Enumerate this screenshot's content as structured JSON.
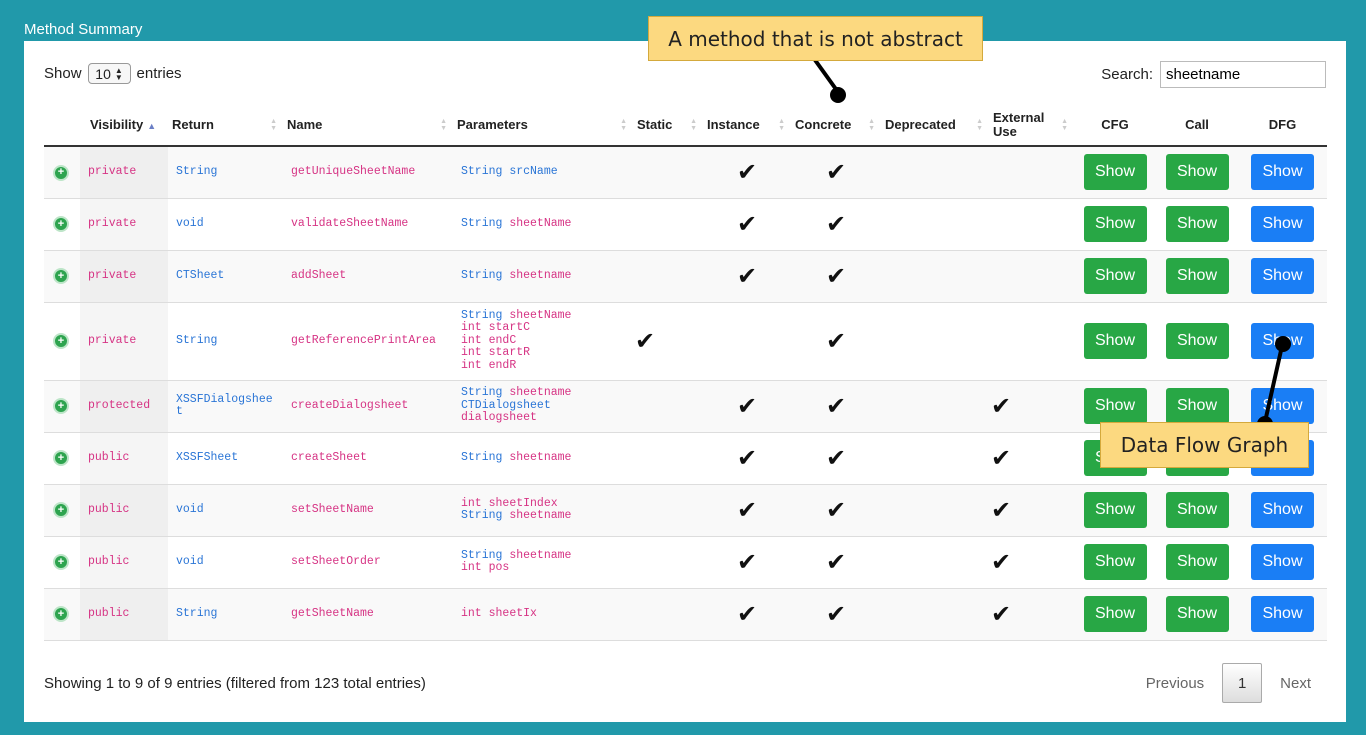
{
  "panel": {
    "title": "Method Summary"
  },
  "length": {
    "prefix": "Show",
    "value": "10",
    "suffix": "entries"
  },
  "search": {
    "label": "Search:",
    "value": "sheetname"
  },
  "columns": [
    {
      "label": ""
    },
    {
      "label": "Visibility"
    },
    {
      "label": "Return"
    },
    {
      "label": "Name"
    },
    {
      "label": "Parameters"
    },
    {
      "label": "Static"
    },
    {
      "label": "Instance"
    },
    {
      "label": "Concrete"
    },
    {
      "label": "Deprecated"
    },
    {
      "label": "External Use"
    },
    {
      "label": "CFG"
    },
    {
      "label": "Call"
    },
    {
      "label": "DFG"
    }
  ],
  "rows": [
    {
      "visibility": "private",
      "return": "String",
      "name": "getUniqueSheetName",
      "params": [
        {
          "type": "String",
          "name": "srcName",
          "tcolor": "blue",
          "ncolor": "blue"
        }
      ],
      "static": false,
      "instance": true,
      "concrete": true,
      "deprecated": false,
      "external": false
    },
    {
      "visibility": "private",
      "return": "void",
      "name": "validateSheetName",
      "params": [
        {
          "type": "String",
          "name": "sheetName",
          "tcolor": "blue",
          "ncolor": "pink"
        }
      ],
      "static": false,
      "instance": true,
      "concrete": true,
      "deprecated": false,
      "external": false
    },
    {
      "visibility": "private",
      "return": "CTSheet",
      "name": "addSheet",
      "params": [
        {
          "type": "String",
          "name": "sheetname",
          "tcolor": "blue",
          "ncolor": "pink"
        }
      ],
      "static": false,
      "instance": true,
      "concrete": true,
      "deprecated": false,
      "external": false
    },
    {
      "visibility": "private",
      "return": "String",
      "name": "getReferencePrintArea",
      "params": [
        {
          "type": "String",
          "name": "sheetName",
          "tcolor": "blue",
          "ncolor": "pink"
        },
        {
          "type": "int",
          "name": "startC",
          "tcolor": "pink",
          "ncolor": "pink"
        },
        {
          "type": "int",
          "name": "endC",
          "tcolor": "pink",
          "ncolor": "pink"
        },
        {
          "type": "int",
          "name": "startR",
          "tcolor": "pink",
          "ncolor": "pink"
        },
        {
          "type": "int",
          "name": "endR",
          "tcolor": "pink",
          "ncolor": "pink"
        }
      ],
      "static": true,
      "instance": false,
      "concrete": true,
      "deprecated": false,
      "external": false
    },
    {
      "visibility": "protected",
      "return": "XSSFDialogsheet",
      "name": "createDialogsheet",
      "params": [
        {
          "type": "String",
          "name": "sheetname",
          "tcolor": "blue",
          "ncolor": "pink"
        },
        {
          "type": "CTDialogsheet",
          "name": "dialogsheet",
          "tcolor": "blue",
          "ncolor": "pink"
        }
      ],
      "static": false,
      "instance": true,
      "concrete": true,
      "deprecated": false,
      "external": true
    },
    {
      "visibility": "public",
      "return": "XSSFSheet",
      "name": "createSheet",
      "params": [
        {
          "type": "String",
          "name": "sheetname",
          "tcolor": "blue",
          "ncolor": "pink"
        }
      ],
      "static": false,
      "instance": true,
      "concrete": true,
      "deprecated": false,
      "external": true
    },
    {
      "visibility": "public",
      "return": "void",
      "name": "setSheetName",
      "params": [
        {
          "type": "int",
          "name": "sheetIndex",
          "tcolor": "pink",
          "ncolor": "pink"
        },
        {
          "type": "String",
          "name": "sheetname",
          "tcolor": "blue",
          "ncolor": "pink"
        }
      ],
      "static": false,
      "instance": true,
      "concrete": true,
      "deprecated": false,
      "external": true
    },
    {
      "visibility": "public",
      "return": "void",
      "name": "setSheetOrder",
      "params": [
        {
          "type": "String",
          "name": "sheetname",
          "tcolor": "blue",
          "ncolor": "pink"
        },
        {
          "type": "int",
          "name": "pos",
          "tcolor": "pink",
          "ncolor": "pink"
        }
      ],
      "static": false,
      "instance": true,
      "concrete": true,
      "deprecated": false,
      "external": true
    },
    {
      "visibility": "public",
      "return": "String",
      "name": "getSheetName",
      "params": [
        {
          "type": "int",
          "name": "sheetIx",
          "tcolor": "pink",
          "ncolor": "pink"
        }
      ],
      "static": false,
      "instance": true,
      "concrete": true,
      "deprecated": false,
      "external": true
    }
  ],
  "buttons": {
    "show_label": "Show"
  },
  "expand_glyph": "+",
  "check_glyph": "✔",
  "footer": {
    "info": "Showing 1 to 9 of 9 entries (filtered from 123 total entries)"
  },
  "pager": {
    "previous": "Previous",
    "current": "1",
    "next": "Next"
  },
  "annotations": {
    "concrete_note": "A method that is not abstract",
    "dfg_note": "Data Flow Graph"
  },
  "colors": {
    "background": "#2199aa",
    "green": "#28a745",
    "blue": "#1a7ef5",
    "pink": "#d63384",
    "type_blue": "#2a75d6",
    "callout": "#fcd980"
  }
}
